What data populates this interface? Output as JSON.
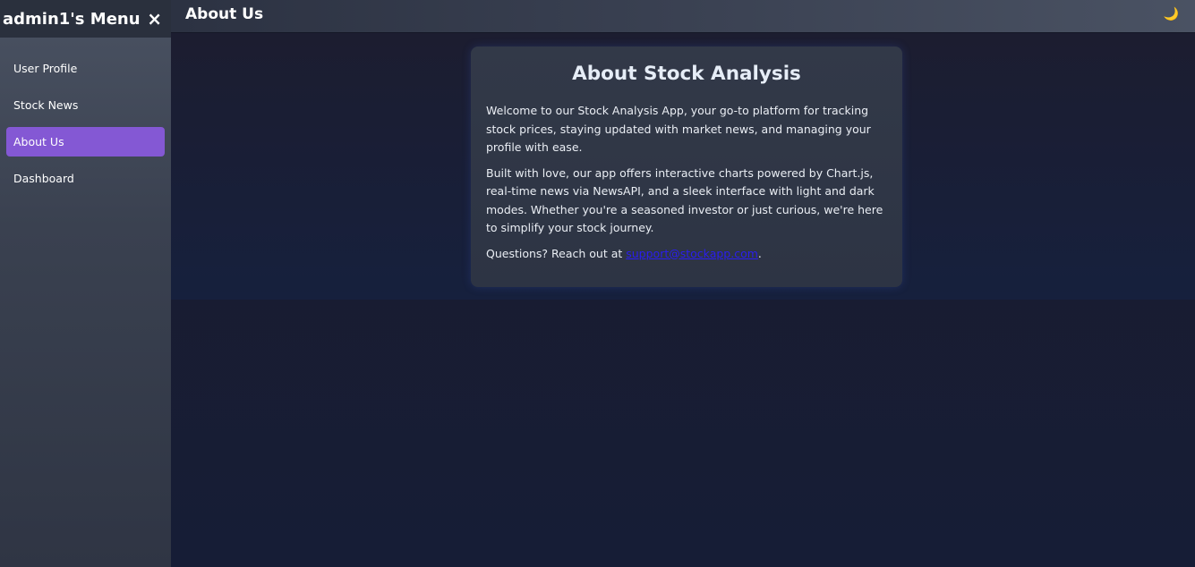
{
  "sidebar": {
    "title": "admin1's Menu",
    "close_icon": "×",
    "items": [
      {
        "label": "User Profile",
        "active": false
      },
      {
        "label": "Stock News",
        "active": false
      },
      {
        "label": "About Us",
        "active": true
      },
      {
        "label": "Dashboard",
        "active": false
      }
    ]
  },
  "header": {
    "title": "About Us",
    "theme_icon": "🌙",
    "theme_icon_name": "moon-icon"
  },
  "card": {
    "title": "About Stock Analysis",
    "paragraph1": "Welcome to our Stock Analysis App, your go-to platform for tracking stock prices, staying updated with market news, and managing your profile with ease.",
    "paragraph2": "Built with love, our app offers interactive charts powered by Chart.js, real-time news via NewsAPI, and a sleek interface with light and dark modes. Whether you're a seasoned investor or just curious, we're here to simplify your stock journey.",
    "contact_prefix": "Questions? Reach out at ",
    "contact_email": "support@stockapp.com",
    "contact_suffix": "."
  },
  "colors": {
    "accent": "#8458d4",
    "link": "#2a1df0",
    "moon": "#f3c24a"
  }
}
